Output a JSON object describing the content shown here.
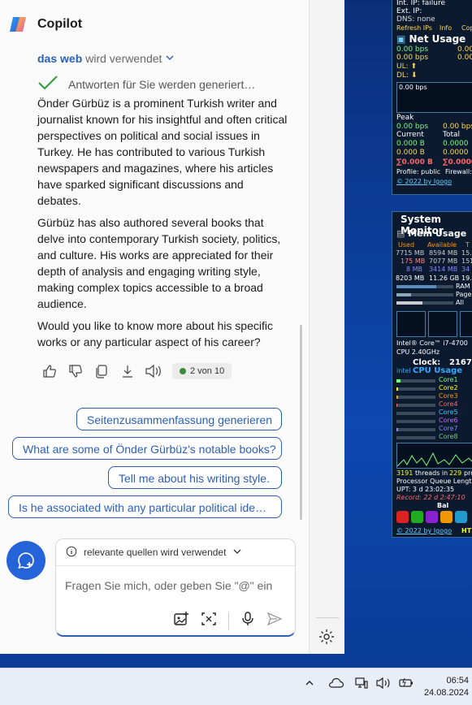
{
  "app": {
    "title": "Copilot"
  },
  "source": {
    "web_label": "das web",
    "suffix": "wird verwendet"
  },
  "generating": {
    "text": "Antworten für Sie werden generiert…"
  },
  "message": {
    "paragraphs": [
      "Önder Gürbüz is a prominent Turkish writer and journalist known for his insightful and often critical perspectives on political and social issues in Turkey. He has contributed to various Turkish newspapers and magazines, where his articles have sparked significant discussions and debates.",
      "Gürbüz has also authored several books that delve into contemporary Turkish society, politics, and culture. His works are appreciated for their depth of analysis and engaging writing style, making complex topics accessible to a broad audience.",
      "Would you like to know more about his specific works or any particular aspect of his career?"
    ]
  },
  "actions": {
    "page_indicator": "2 von 10"
  },
  "suggestions": [
    "Seitenzusammenfassung generieren",
    "What are some of Önder Gürbüz's notable books?",
    "Tell me about his writing style.",
    "Is he associated with any particular political ide…"
  ],
  "input": {
    "sources_label": "relevante quellen wird verwendet",
    "placeholder": "Fragen Sie mich, oder geben Sie \"@\" ein"
  },
  "widget_net": {
    "lines_top": [
      "Int. IP: failure",
      "Ext. IP:",
      "DNS: none"
    ],
    "links": [
      "Refresh IPs",
      "Info",
      "Cop"
    ],
    "title": "Net Usage",
    "ul": "0.00 bps",
    "dl": "0.00 bps",
    "ul_b": "0.00 B",
    "dl_b": "0.00 B",
    "graph_label": "0.00 bps",
    "peak_label": "Peak",
    "peak_ul": "0.00 bps",
    "peak_dl": "0.00 bps",
    "peak_ul2": "0.00 b",
    "current_label": "Current",
    "total_label": "Total",
    "cur_ul": "0.000 B",
    "cur_dl": "0.000 B",
    "tot_ul": "0.0000",
    "tot_dl": "0.0000",
    "sum1": "∑0.000 B",
    "sum2": "∑0.0000",
    "profile": "Profile: public",
    "firewall": "Firewall:",
    "footer": "© 2022 by Igogo"
  },
  "widget_sys": {
    "title": "System Monitor",
    "mem_title": "Mem Usage",
    "col_used": "Used",
    "col_avail": "Available",
    "col_t": "T",
    "mem_rows": [
      [
        "7715 MB",
        "8594 MB",
        "15."
      ],
      [
        "175 MB",
        "7077 MB",
        "151"
      ],
      [
        "8 MB",
        "3414 MB",
        "34"
      ],
      [
        "8203 MB",
        "11.26 GB",
        "19."
      ]
    ],
    "bars": [
      "RAM",
      "Page",
      "All"
    ],
    "cpu_name": "Intel® Core™ i7-4700",
    "cpu_ghz": "CPU 2.40GHz",
    "clock_label": "Clock:",
    "clock_val": "2167",
    "cpu_title": "CPU Usage",
    "cores": [
      "Core1",
      "Core2",
      "Core3",
      "Core4",
      "Core5",
      "Core6",
      "Core7",
      "Core8"
    ],
    "threads_val": "3191",
    "threads_label": "threads in",
    "proc_val": "229",
    "proc_label": "pro",
    "queue": "Processor Queue Lengtl",
    "upt": "UPT: 3 d 23:02:35",
    "record": "Record: 22 d 2:47:10",
    "bal": "Bal",
    "footer": "© 2022 by Igogo",
    "ht": "HT"
  },
  "taskbar": {
    "time": "06:54",
    "date": "24.08.2024"
  },
  "colors": {
    "accent": "#2b5fb8",
    "newchat": "#2563d9",
    "widget_bg": "#0b1a2e"
  }
}
